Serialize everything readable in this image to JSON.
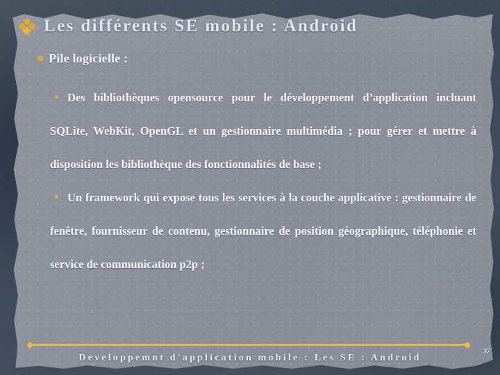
{
  "slide": {
    "title": "Les différents SE mobile : Android",
    "title_bullet_icon": "diamond-cluster-icon",
    "subheading": "Pile logicielle :",
    "subheading_bullet_icon": "square-bullet-icon",
    "bullets": [
      {
        "bullet_icon": "round-dot-icon",
        "text": "Des bibliothèques opensource pour le développement d’application incluant SQLite, WebKit, OpenGL et un gestionnaire multimédia ; pour gérer et mettre à disposition les bibliothèque des fonctionnalités de base ;"
      },
      {
        "bullet_icon": "round-dot-icon",
        "text": "Un framework qui expose tous les services à la couche applicative : gestionnaire de fenêtre, fournisseur de contenu, gestionnaire de position géographique, téléphonie et service de communication p2p ;"
      }
    ]
  },
  "footer": {
    "text": "Developpemnt d'application mobile : Les SE : Android",
    "page_number": "37"
  },
  "colors": {
    "accent_gold": "#eab73f",
    "bullet_gold": "#e4a72c",
    "title_text": "#dde5f2",
    "body_text": "#f4f6fa",
    "paper_bg": "#8b909b",
    "board_bg": "#3c4858"
  }
}
